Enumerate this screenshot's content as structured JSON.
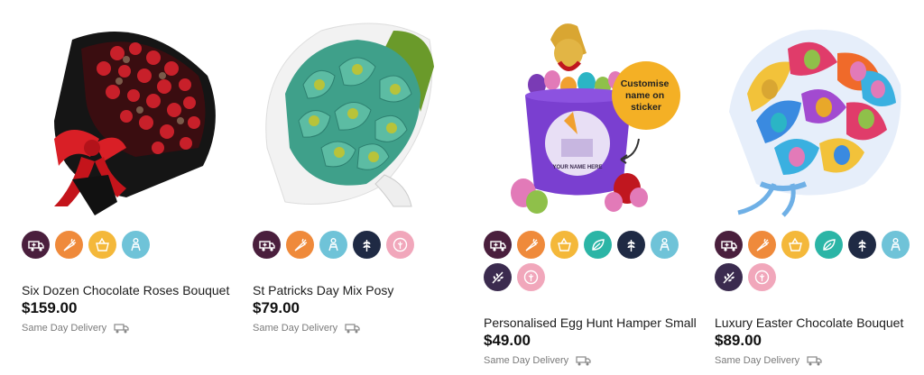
{
  "products": [
    {
      "title": "Six Dozen Chocolate Roses Bouquet",
      "price": "$159.00",
      "delivery": "Same Day Delivery",
      "badges": [
        "ambulance-icon",
        "carrot-icon",
        "basket-icon",
        "person-icon"
      ]
    },
    {
      "title": "St Patricks Day Mix Posy",
      "price": "$79.00",
      "delivery": "Same Day Delivery",
      "badges": [
        "ambulance-icon",
        "carrot-icon",
        "person-icon",
        "wheat-icon",
        "no-gluten-icon"
      ]
    },
    {
      "title": "Personalised Egg Hunt Hamper Small",
      "price": "$49.00",
      "delivery": "Same Day Delivery",
      "sticker_text": "Customise name on sticker",
      "bucket_label": "YOUR NAME HERE",
      "badges": [
        "ambulance-icon",
        "carrot-icon",
        "basket-icon",
        "leaf-icon",
        "wheat-icon",
        "person-icon",
        "wheat-alt-icon",
        "no-gluten-icon"
      ]
    },
    {
      "title": "Luxury Easter Chocolate Bouquet",
      "price": "$89.00",
      "delivery": "Same Day Delivery",
      "badges": [
        "ambulance-icon",
        "carrot-icon",
        "basket-icon",
        "leaf-icon",
        "wheat-icon",
        "person-icon",
        "wheat-alt-icon",
        "no-gluten-icon"
      ]
    }
  ],
  "badge_colors": {
    "ambulance-icon": "#4a1f3d",
    "carrot-icon": "#ef8a3b",
    "basket-icon": "#f4b83a",
    "leaf-icon": "#2bb5a6",
    "wheat-icon": "#1f2a44",
    "person-icon": "#6fc3d8",
    "wheat-alt-icon": "#3b2b4f",
    "no-gluten-icon": "#f1a7bb"
  }
}
